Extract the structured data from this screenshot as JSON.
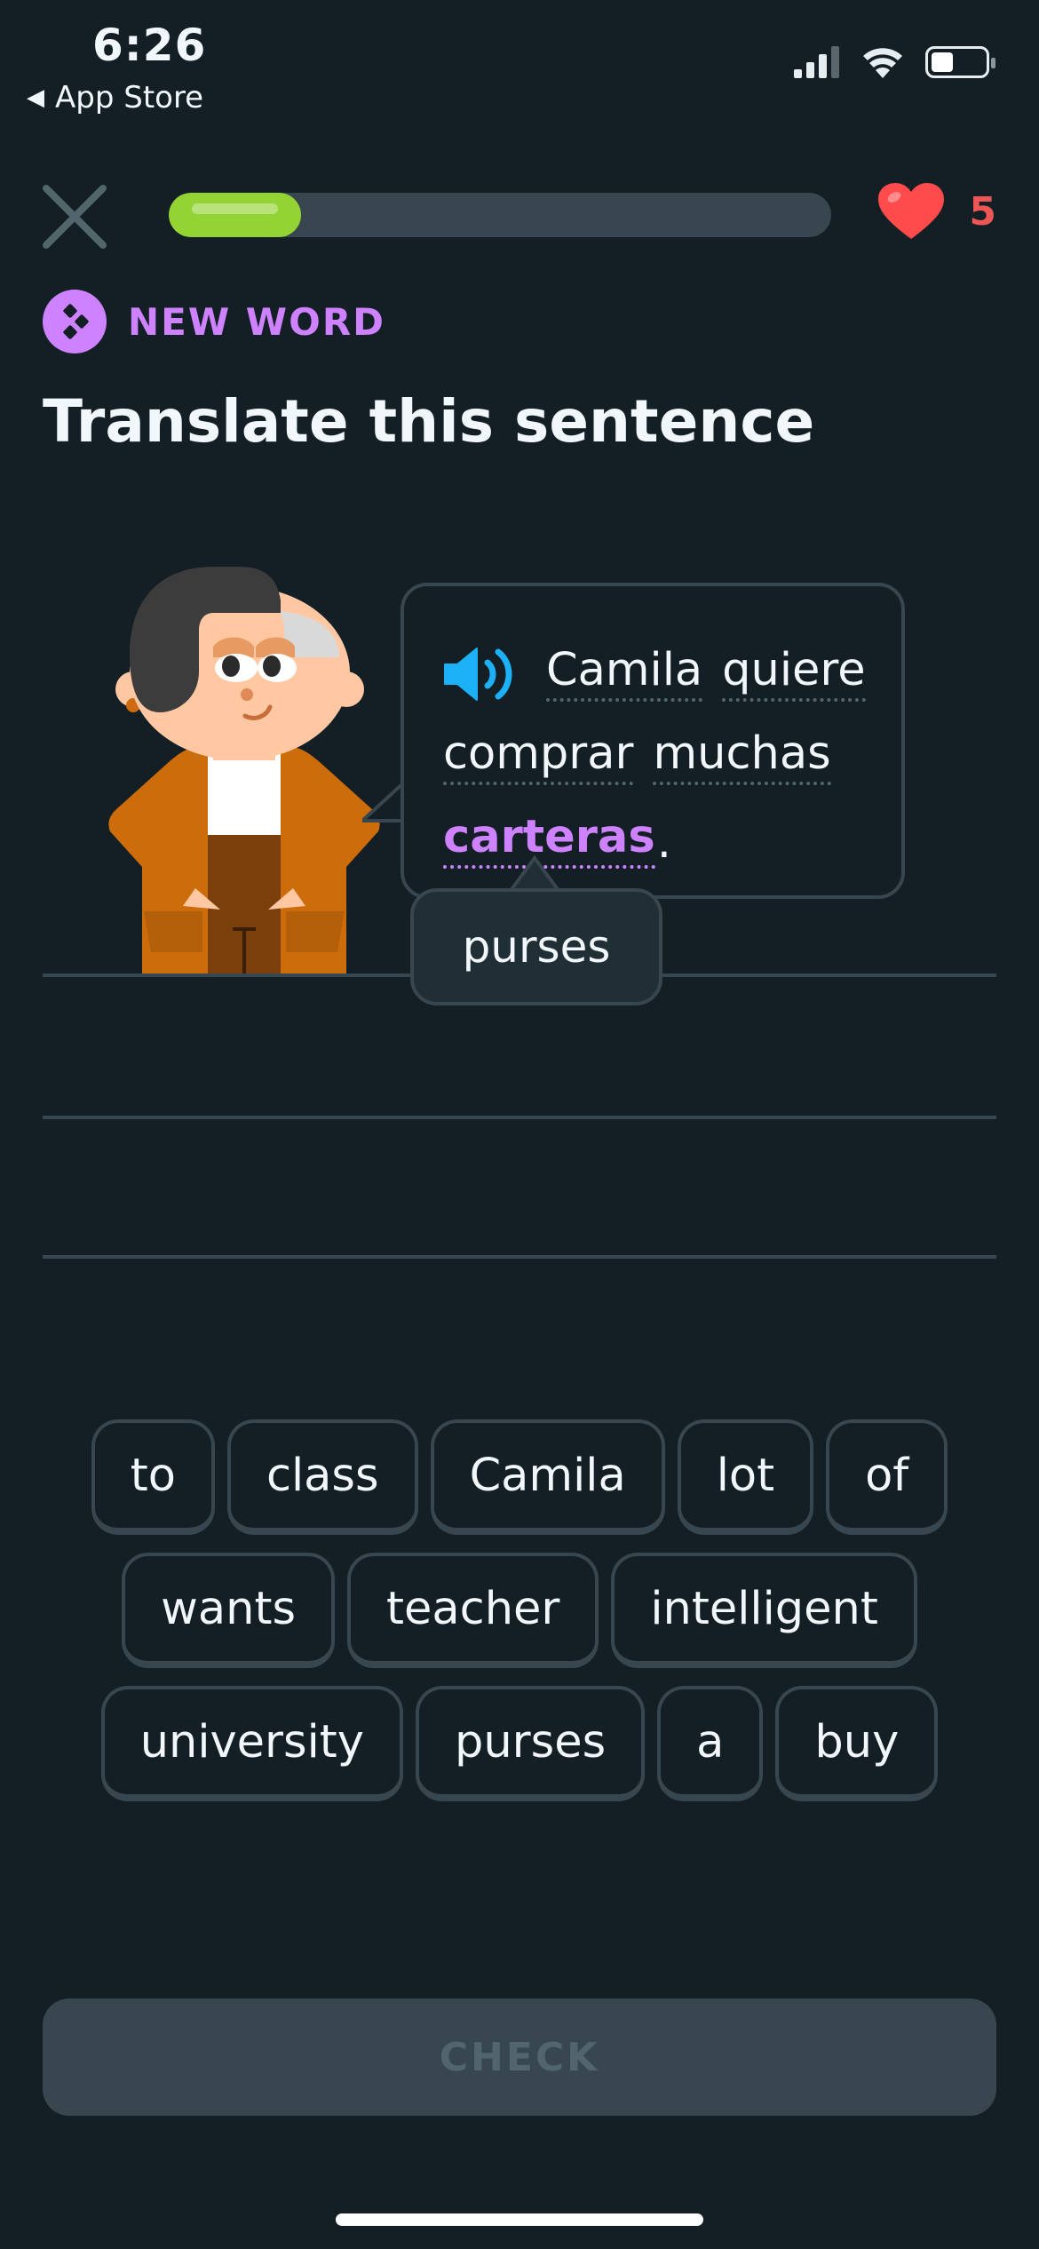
{
  "status_bar": {
    "time": "6:26",
    "back_label": "App Store"
  },
  "lesson": {
    "progress_fraction": 0.2,
    "hearts": "5"
  },
  "badge": {
    "label": "NEW WORD"
  },
  "prompt": {
    "title": "Translate this sentence"
  },
  "sentence": {
    "line1": [
      "Camila",
      "quiere"
    ],
    "line2": [
      "comprar",
      "muchas"
    ],
    "new_word": "carteras",
    "punctuation": "."
  },
  "hint": {
    "translation": "purses"
  },
  "word_bank": {
    "rows": [
      [
        "to",
        "class",
        "Camila",
        "lot",
        "of"
      ],
      [
        "wants",
        "teacher",
        "intelligent"
      ],
      [
        "university",
        "purses",
        "a",
        "buy"
      ]
    ]
  },
  "actions": {
    "check_label": "CHECK"
  },
  "colors": {
    "background": "#131f24",
    "accent_purple": "#ce82ff",
    "progress_green": "#93d333",
    "heart_red": "#ee5555",
    "speaker_blue": "#1cb0f6",
    "border": "#37464f"
  },
  "icons": [
    "signal-icon",
    "wifi-icon",
    "battery-icon",
    "close-icon",
    "heart-icon",
    "new-word-icon",
    "speaker-icon"
  ]
}
